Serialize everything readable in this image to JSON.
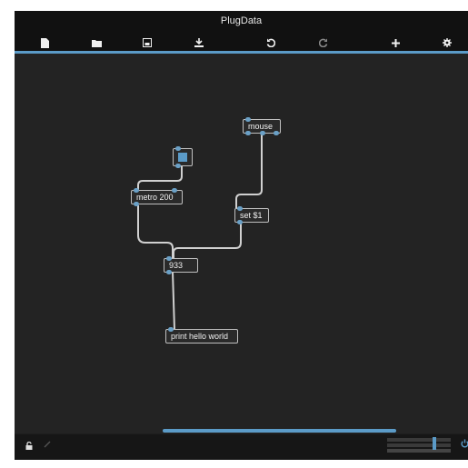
{
  "app": {
    "title": "PlugData"
  },
  "toolbar": {
    "items": [
      {
        "name": "new-file-icon",
        "glyph": "▪"
      },
      {
        "name": "open-folder-icon",
        "glyph": "■"
      },
      {
        "name": "save-icon",
        "glyph": "▫"
      },
      {
        "name": "save-as-icon",
        "glyph": "⤓"
      },
      {
        "name": "undo-icon",
        "glyph": "↺"
      },
      {
        "name": "redo-icon",
        "glyph": "↻"
      },
      {
        "name": "add-object-icon",
        "glyph": "+"
      },
      {
        "name": "settings-gear-icon",
        "glyph": "⚙"
      }
    ]
  },
  "patch": {
    "objects": {
      "mouse": "mouse",
      "metro": "metro 200",
      "set": "set $1",
      "number": "933",
      "print": "print hello world"
    },
    "toggle": {
      "state": "on"
    }
  },
  "statusbar": {
    "lock_icon": "lock-icon",
    "edit_icon": "pencil-icon",
    "power_icon": "power-icon"
  },
  "colors": {
    "accent": "#5b9bc8",
    "background": "#232323",
    "toolbar": "#111111"
  }
}
